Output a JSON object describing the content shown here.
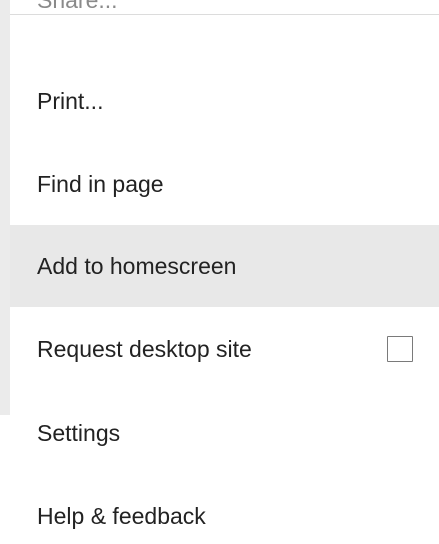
{
  "menu": {
    "items": [
      {
        "label": "Share..."
      },
      {
        "label": "Print..."
      },
      {
        "label": "Find in page"
      },
      {
        "label": "Add to homescreen"
      },
      {
        "label": "Request desktop site",
        "checked": false
      },
      {
        "label": "Settings"
      },
      {
        "label": "Help & feedback"
      }
    ]
  },
  "colors": {
    "highlight": "#e8e8e8",
    "text": "#222222",
    "divider": "#dcdcdc"
  }
}
